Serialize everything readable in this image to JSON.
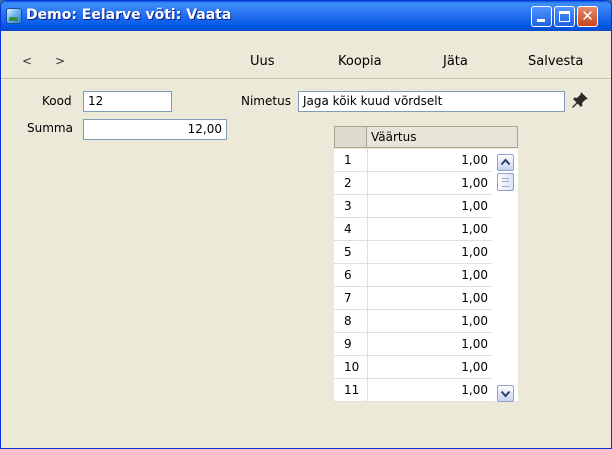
{
  "window": {
    "title": "Demo: Eelarve võti: Vaata",
    "close_glyph": "✕"
  },
  "toolbar": {
    "prev": "<",
    "next": ">",
    "new_label": "Uus",
    "copy_label": "Koopia",
    "skip_label": "Jäta",
    "save_label": "Salvesta"
  },
  "form": {
    "kood_label": "Kood",
    "kood_value": "12",
    "summa_label": "Summa",
    "summa_value": "12,00",
    "nimetus_label": "Nimetus",
    "nimetus_value": "Jaga kõik kuud võrdselt"
  },
  "grid": {
    "column_header": "Väärtus",
    "rows": [
      {
        "n": "1",
        "value": "1,00"
      },
      {
        "n": "2",
        "value": "1,00"
      },
      {
        "n": "3",
        "value": "1,00"
      },
      {
        "n": "4",
        "value": "1,00"
      },
      {
        "n": "5",
        "value": "1,00"
      },
      {
        "n": "6",
        "value": "1,00"
      },
      {
        "n": "7",
        "value": "1,00"
      },
      {
        "n": "8",
        "value": "1,00"
      },
      {
        "n": "9",
        "value": "1,00"
      },
      {
        "n": "10",
        "value": "1,00"
      },
      {
        "n": "11",
        "value": "1,00"
      }
    ]
  },
  "icons": {
    "app": "app-icon",
    "pin": "pin-icon",
    "scroll_up": "chevron-up-icon",
    "scroll_down": "chevron-down-icon"
  }
}
